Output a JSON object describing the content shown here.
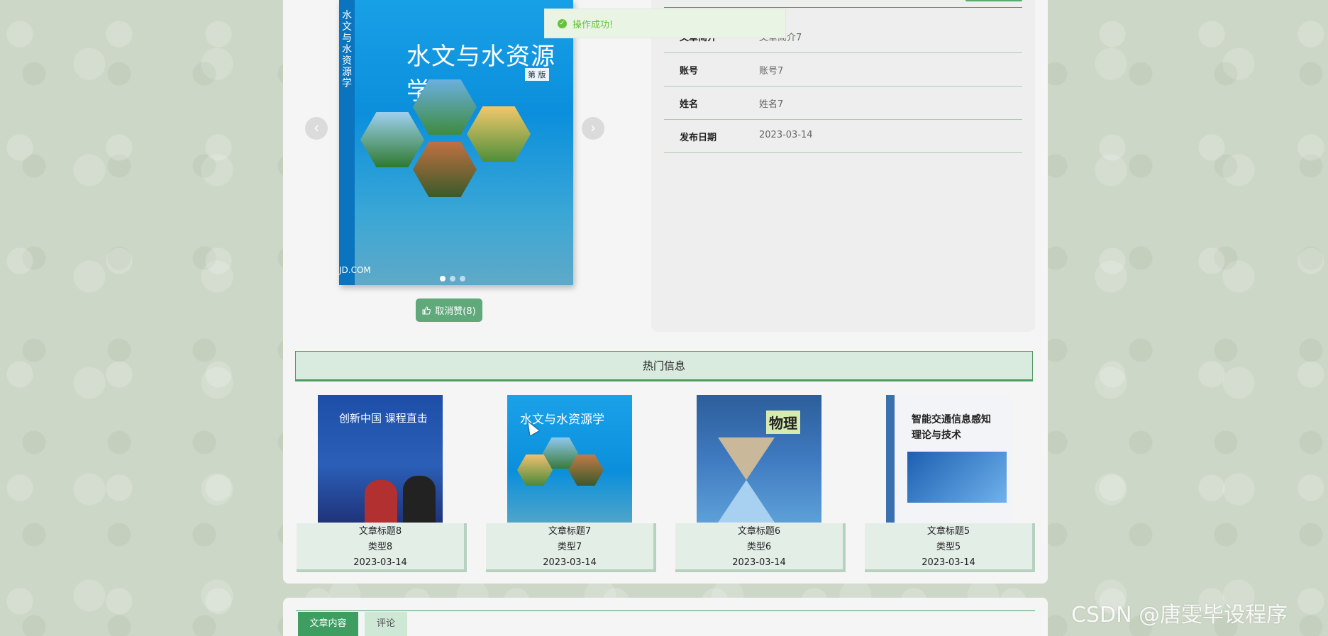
{
  "toast": {
    "message": "操作成功!"
  },
  "detail": {
    "rows": [
      {
        "label": "文章简介",
        "value": "文章简介7"
      },
      {
        "label": "账号",
        "value": "账号7"
      },
      {
        "label": "姓名",
        "value": "姓名7"
      },
      {
        "label": "发布日期",
        "value": "2023-03-14"
      }
    ]
  },
  "carousel": {
    "book_title": "水文与水资源学",
    "book_spine_title": "水文与水资源学",
    "book_edition": "第 版",
    "book_publisher": "JD.COM",
    "prev_icon": "‹",
    "next_icon": "›"
  },
  "like_button": {
    "label": "取消赞(8)"
  },
  "hot": {
    "header": "热门信息",
    "items": [
      {
        "title": "文章标题8",
        "type": "类型8",
        "date": "2023-03-14",
        "cover_text": "创新中国 课程直击"
      },
      {
        "title": "文章标题7",
        "type": "类型7",
        "date": "2023-03-14",
        "cover_text": "水文与水资源学"
      },
      {
        "title": "文章标题6",
        "type": "类型6",
        "date": "2023-03-14",
        "cover_text": "物理"
      },
      {
        "title": "文章标题5",
        "type": "类型5",
        "date": "2023-03-14",
        "cover_text": "智能交通信息感知理论与技术"
      }
    ]
  },
  "tabs": [
    {
      "label": "文章内容"
    },
    {
      "label": "评论"
    }
  ],
  "watermark": "CSDN @唐雯毕设程序",
  "colors": {
    "accent": "#3e9e62",
    "header_bg": "#d9ebdf",
    "toast_text": "#67c23a"
  }
}
